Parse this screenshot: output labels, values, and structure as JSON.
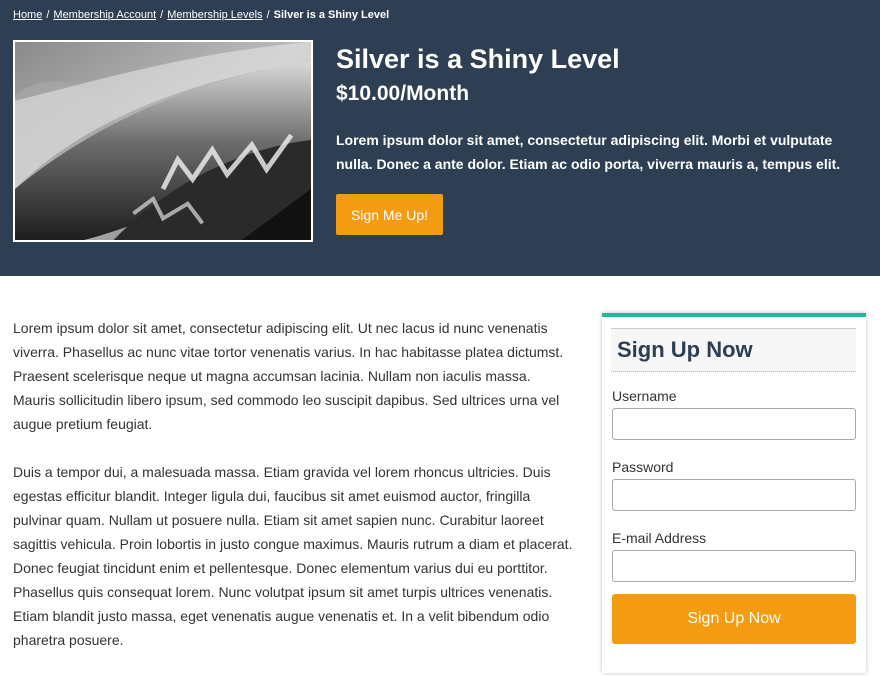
{
  "breadcrumb": {
    "items": [
      {
        "label": "Home"
      },
      {
        "label": "Membership Account"
      },
      {
        "label": "Membership Levels"
      }
    ],
    "separator": "/",
    "current": "Silver is a Shiny Level"
  },
  "level": {
    "title": "Silver is a Shiny Level",
    "price": "$10.00/Month",
    "description": "Lorem ipsum dolor sit amet, consectetur adipiscing elit. Morbi et vulputate nulla. Donec a ante dolor. Etiam ac odio porta, viverra mauris a, tempus elit.",
    "cta_label": "Sign Me Up!"
  },
  "content": {
    "paragraphs": [
      "Lorem ipsum dolor sit amet, consectetur adipiscing elit. Ut nec lacus id nunc venenatis viverra. Phasellus ac nunc vitae tortor venenatis varius. In hac habitasse platea dictumst. Praesent scelerisque neque ut magna accumsan lacinia. Nullam non iaculis massa. Mauris sollicitudin libero ipsum, sed commodo leo suscipit dapibus. Sed ultrices urna vel augue pretium feugiat.",
      "Duis a tempor dui, a malesuada massa. Etiam gravida vel lorem rhoncus ultricies. Duis egestas efficitur blandit. Integer ligula dui, faucibus sit amet euismod auctor, fringilla pulvinar quam. Nullam ut posuere nulla. Etiam sit amet sapien nunc. Curabitur laoreet sagittis vehicula. Proin lobortis in justo congue maximus. Mauris rutrum a diam et placerat. Donec feugiat tincidunt enim et pellentesque. Donec elementum varius dui eu porttitor. Phasellus quis consequat lorem. Nunc volutpat ipsum sit amet turpis ultrices venenatis. Etiam blandit justo massa, eget venenatis augue venenatis et. In a velit bibendum odio pharetra posuere."
    ]
  },
  "signup": {
    "heading": "Sign Up Now",
    "username_label": "Username",
    "username_value": "",
    "password_label": "Password",
    "password_value": "",
    "email_label": "E-mail Address",
    "email_value": "",
    "submit_label": "Sign Up Now"
  },
  "colors": {
    "hero_bg": "#2e3e53",
    "accent_orange": "#f39c12",
    "accent_teal": "#1abc9c"
  }
}
